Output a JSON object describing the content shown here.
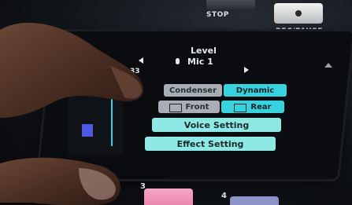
{
  "hardware": {
    "stop_label": "STOP",
    "rec_pause_label": "REC/PAUSE",
    "pad_number_left": "3",
    "pad_number_right": "4"
  },
  "screen": {
    "title": "Level",
    "channel": "Mic 1",
    "channel_number": "33",
    "mic_type": {
      "option_a": "Condenser",
      "option_b": "Dynamic",
      "selected": "Dynamic"
    },
    "position": {
      "option_a": "Front",
      "option_b": "Rear",
      "selected": "Rear"
    },
    "voice_setting_label": "Voice Setting",
    "effect_setting_label": "Effect Setting"
  },
  "colors": {
    "accent_cyan": "#36d3df",
    "light_teal": "#8ee8e3",
    "pink_pad": "#ee88b0"
  }
}
